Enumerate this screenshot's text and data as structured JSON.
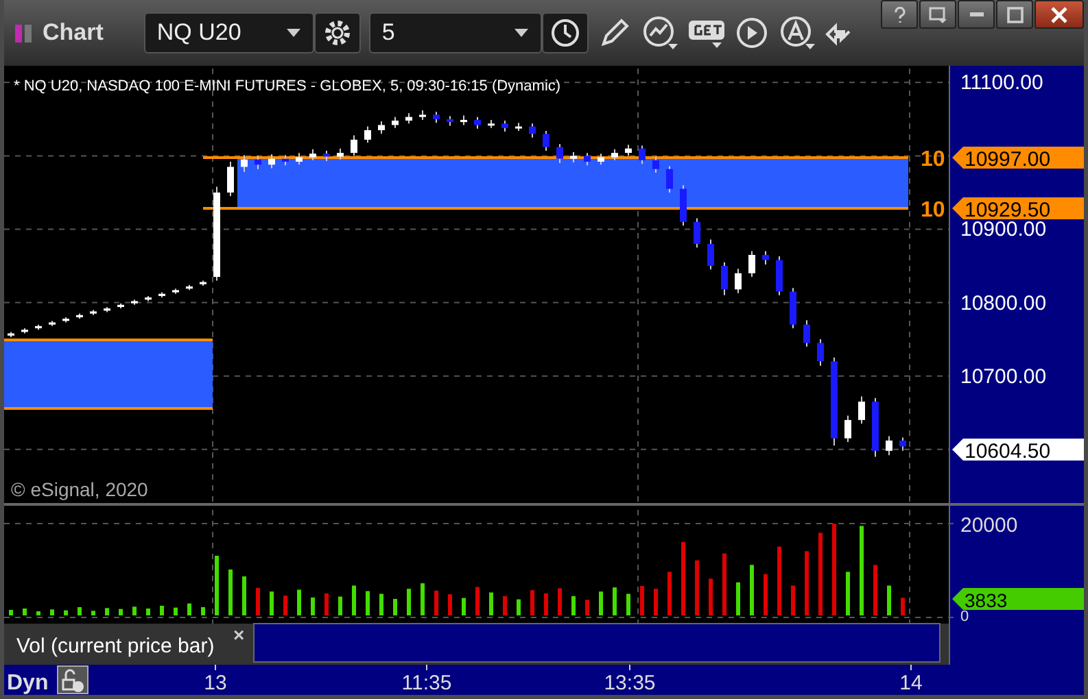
{
  "window": {
    "title": "Chart"
  },
  "toolbar": {
    "symbol": "NQ U20",
    "interval": "5"
  },
  "chart": {
    "legend": "* NQ U20, NASDAQ 100 E-MINI FUTURES - GLOBEX, 5, 09:30-16:15 (Dynamic)",
    "copyright": "© eSignal, 2020",
    "price_tags": [
      {
        "kind": "level",
        "marker": "10",
        "text": "10997.00"
      },
      {
        "kind": "level",
        "marker": "10",
        "text": "10929.50"
      },
      {
        "kind": "last",
        "text": "10604.50"
      }
    ],
    "chart_data": {
      "type": "candlestick",
      "grid": true,
      "ylim": [
        10525,
        11119
      ],
      "ohlc": [
        [
          10755,
          10760,
          10753,
          10758
        ],
        [
          10760,
          10765,
          10758,
          10763
        ],
        [
          10765,
          10770,
          10763,
          10768
        ],
        [
          10770,
          10775,
          10768,
          10773
        ],
        [
          10775,
          10780,
          10773,
          10778
        ],
        [
          10780,
          10785,
          10778,
          10783
        ],
        [
          10785,
          10790,
          10783,
          10788
        ],
        [
          10789,
          10794,
          10787,
          10792
        ],
        [
          10794,
          10799,
          10792,
          10797
        ],
        [
          10799,
          10804,
          10797,
          10802
        ],
        [
          10804,
          10809,
          10802,
          10807
        ],
        [
          10809,
          10814,
          10807,
          10812
        ],
        [
          10814,
          10819,
          10812,
          10817
        ],
        [
          10819,
          10824,
          10817,
          10822
        ],
        [
          10825,
          10830,
          10823,
          10828
        ],
        [
          10835,
          10958,
          10830,
          10950
        ],
        [
          10950,
          10992,
          10945,
          10985
        ],
        [
          10985,
          11001,
          10978,
          10995
        ],
        [
          10995,
          11000,
          10982,
          10988
        ],
        [
          10988,
          11002,
          10983,
          10996
        ],
        [
          10996,
          11001,
          10987,
          10992
        ],
        [
          10992,
          11004,
          10988,
          10998
        ],
        [
          10998,
          11009,
          10994,
          11003
        ],
        [
          11003,
          11007,
          10993,
          10999
        ],
        [
          10999,
          11010,
          10995,
          11004
        ],
        [
          11004,
          11028,
          11000,
          11022
        ],
        [
          11022,
          11040,
          11018,
          11035
        ],
        [
          11035,
          11047,
          11030,
          11042
        ],
        [
          11042,
          11053,
          11038,
          11048
        ],
        [
          11048,
          11058,
          11044,
          11053
        ],
        [
          11053,
          11062,
          11049,
          11056
        ],
        [
          11056,
          11060,
          11045,
          11050
        ],
        [
          11050,
          11054,
          11041,
          11046
        ],
        [
          11046,
          11055,
          11042,
          11049
        ],
        [
          11049,
          11053,
          11037,
          11042
        ],
        [
          11042,
          11049,
          11038,
          11044
        ],
        [
          11044,
          11048,
          11033,
          11038
        ],
        [
          11038,
          11045,
          11034,
          11040
        ],
        [
          11040,
          11044,
          11025,
          11030
        ],
        [
          11030,
          11034,
          11007,
          11012
        ],
        [
          11012,
          11016,
          10990,
          10996
        ],
        [
          10996,
          11005,
          10991,
          11000
        ],
        [
          11000,
          11004,
          10987,
          10992
        ],
        [
          10992,
          11003,
          10988,
          10998
        ],
        [
          10998,
          11009,
          10994,
          11004
        ],
        [
          11004,
          11015,
          11000,
          11010
        ],
        [
          11010,
          11014,
          10989,
          10994
        ],
        [
          10994,
          10999,
          10977,
          10982
        ],
        [
          10982,
          10986,
          10950,
          10955
        ],
        [
          10955,
          10960,
          10905,
          10910
        ],
        [
          10910,
          10915,
          10875,
          10880
        ],
        [
          10880,
          10886,
          10845,
          10850
        ],
        [
          10850,
          10855,
          10810,
          10818
        ],
        [
          10818,
          10846,
          10813,
          10840
        ],
        [
          10840,
          10870,
          10835,
          10865
        ],
        [
          10865,
          10870,
          10852,
          10858
        ],
        [
          10858,
          10863,
          10810,
          10815
        ],
        [
          10815,
          10820,
          10765,
          10770
        ],
        [
          10770,
          10776,
          10740,
          10745
        ],
        [
          10745,
          10750,
          10714,
          10720
        ],
        [
          10720,
          10725,
          10605,
          10615
        ],
        [
          10615,
          10646,
          10610,
          10640
        ],
        [
          10640,
          10672,
          10635,
          10665
        ],
        [
          10665,
          10670,
          10590,
          10598
        ],
        [
          10598,
          10618,
          10592,
          10612
        ],
        [
          10612,
          10616,
          10598,
          10604
        ]
      ],
      "yticks": [
        {
          "value": 11100,
          "label": "11100.00"
        },
        {
          "value": 10900,
          "label": "10900.00"
        },
        {
          "value": 10800,
          "label": "10800.00"
        },
        {
          "value": 10700,
          "label": "10700.00"
        }
      ]
    }
  },
  "volume": {
    "tag": "3833",
    "study_label": "Vol (current price bar)",
    "close": "×",
    "chart_data": {
      "type": "bar",
      "values": [
        1200,
        1500,
        900,
        1300,
        1100,
        1800,
        1000,
        1600,
        1400,
        1900,
        1500,
        2100,
        1700,
        2600,
        1800,
        13000,
        10000,
        8500,
        6000,
        5200,
        4300,
        5600,
        3900,
        4800,
        4100,
        6500,
        5300,
        4700,
        3600,
        5800,
        7000,
        5400,
        4600,
        3800,
        6200,
        5000,
        4200,
        3500,
        5500,
        4800,
        5900,
        4200,
        3400,
        5200,
        6100,
        4700,
        6400,
        5800,
        9500,
        16000,
        12000,
        8000,
        13500,
        7200,
        11000,
        9000,
        15000,
        6500,
        14000,
        18000,
        20000,
        9500,
        19500,
        11000,
        6500,
        3833
      ],
      "grid": true,
      "ylim": [
        0,
        23000
      ],
      "yticks": [
        {
          "value": 20000,
          "label": "20000"
        },
        {
          "value": 0,
          "label": "0"
        }
      ]
    }
  },
  "time_axis": {
    "mode": "Dyn",
    "labels": [
      "13",
      "11:35",
      "13:35",
      "14"
    ]
  }
}
